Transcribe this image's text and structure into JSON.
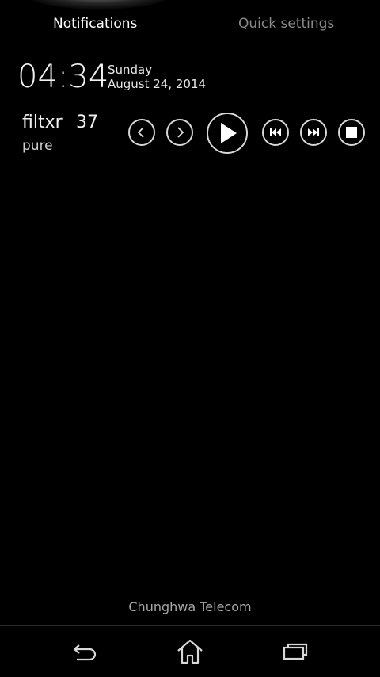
{
  "tabs": {
    "notifications": "Notifications",
    "quick_settings": "Quick settings"
  },
  "clock": {
    "time": "04:34",
    "day": "Sunday",
    "date": "August 24, 2014"
  },
  "widget": {
    "name": "filtxr",
    "number": "37",
    "subtitle": "pure"
  },
  "media_controls": [
    "previous-page",
    "next-page",
    "play",
    "skip-back",
    "skip-forward",
    "stop"
  ],
  "carrier": "Chunghwa Telecom",
  "nav": [
    "back",
    "home",
    "recent-apps"
  ],
  "colors": {
    "background": "#000000",
    "active_tab": "#ffffff",
    "inactive_tab": "#8a8a8a",
    "carrier_text": "#a8a8a8"
  }
}
